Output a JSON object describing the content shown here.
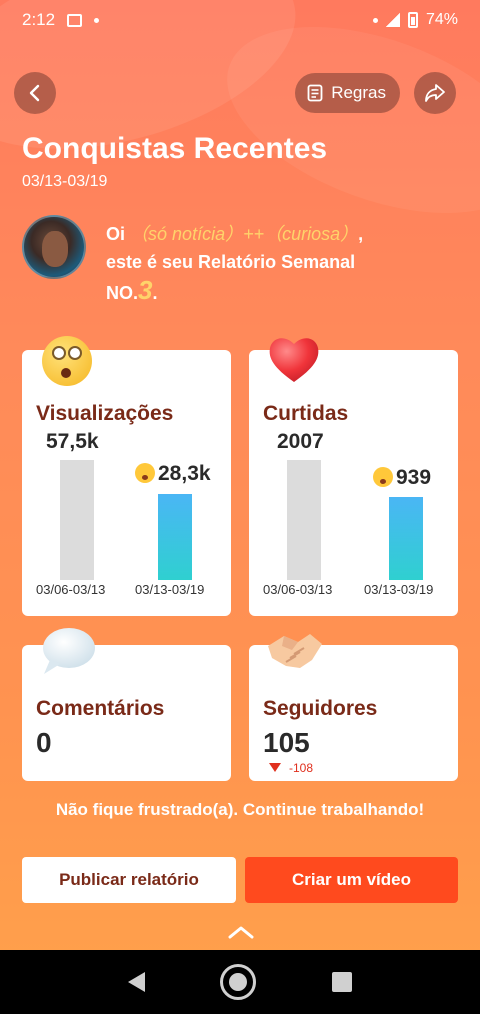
{
  "status_bar": {
    "time": "2:12",
    "battery": "74%"
  },
  "header": {
    "rules_label": "Regras",
    "title": "Conquistas Recentes",
    "date_range": "03/13-03/19"
  },
  "greeting": {
    "hi": "Oi",
    "name": "（só notícia）++（curiosa）",
    "comma": ",",
    "line2": "este é seu Relatório Semanal",
    "no_label": "NO.",
    "no_value": "3",
    "period": "."
  },
  "views_card": {
    "title": "Visualizações",
    "prev_value": "57,5k",
    "cur_value": "28,3k",
    "prev_date": "03/06-03/13",
    "cur_date": "03/13-03/19",
    "prev_fraction": 1.0,
    "cur_fraction": 0.72
  },
  "likes_card": {
    "title": "Curtidas",
    "prev_value": "2007",
    "cur_value": "939",
    "prev_date": "03/06-03/13",
    "cur_date": "03/13-03/19",
    "prev_fraction": 1.0,
    "cur_fraction": 0.69
  },
  "comments_card": {
    "title": "Comentários",
    "value": "0"
  },
  "followers_card": {
    "title": "Seguidores",
    "value": "105",
    "change": "-108"
  },
  "encourage_text": "Não fique frustrado(a). Continue trabalhando!",
  "buttons": {
    "publish": "Publicar relatório",
    "create": "Criar um vídeo"
  },
  "colors": {
    "accent": "#ff4a1e",
    "card_title": "#7a2a18",
    "bar_current": "#3ec3e8",
    "bar_previous": "#dcdcdc"
  }
}
